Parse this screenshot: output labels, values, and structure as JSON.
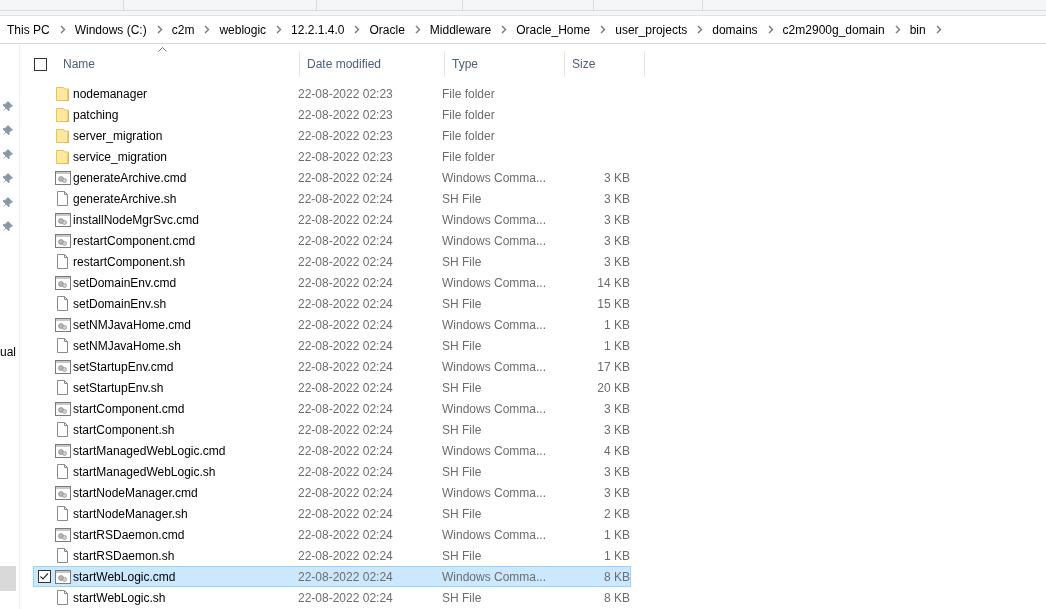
{
  "breadcrumb": [
    "This PC",
    "Windows (C:)",
    "c2m",
    "weblogic",
    "12.2.1.4.0",
    "Oracle",
    "Middleware",
    "Oracle_Home",
    "user_projects",
    "domains",
    "c2m2900g_domain",
    "bin"
  ],
  "nav_items": [
    {
      "label": "ual",
      "selected": false
    },
    {
      "selected": true
    }
  ],
  "table": {
    "select_all": {
      "checked": false
    },
    "columns": [
      {
        "label": "Name",
        "sorted": true
      },
      {
        "label": "Date modified",
        "sorted": false
      },
      {
        "label": "Type",
        "sorted": false
      },
      {
        "label": "Size",
        "sorted": false
      }
    ],
    "rows": [
      {
        "kind": "folder",
        "name": "nodemanager",
        "date": "22-08-2022 02:23",
        "type": "File folder",
        "selected": false
      },
      {
        "kind": "folder",
        "name": "patching",
        "date": "22-08-2022 02:23",
        "type": "File folder",
        "selected": false
      },
      {
        "kind": "folder",
        "name": "server_migration",
        "date": "22-08-2022 02:23",
        "type": "File folder",
        "selected": false
      },
      {
        "kind": "folder",
        "name": "service_migration",
        "date": "22-08-2022 02:23",
        "type": "File folder",
        "selected": false
      },
      {
        "kind": "cmd",
        "name": "generateArchive.cmd",
        "date": "22-08-2022 02:24",
        "type": "Windows Comma...",
        "size": "3 KB",
        "selected": false
      },
      {
        "kind": "sh",
        "name": "generateArchive.sh",
        "date": "22-08-2022 02:24",
        "type": "SH File",
        "size": "3 KB",
        "selected": false
      },
      {
        "kind": "cmd",
        "name": "installNodeMgrSvc.cmd",
        "date": "22-08-2022 02:24",
        "type": "Windows Comma...",
        "size": "3 KB",
        "selected": false
      },
      {
        "kind": "cmd",
        "name": "restartComponent.cmd",
        "date": "22-08-2022 02:24",
        "type": "Windows Comma...",
        "size": "3 KB",
        "selected": false
      },
      {
        "kind": "sh",
        "name": "restartComponent.sh",
        "date": "22-08-2022 02:24",
        "type": "SH File",
        "size": "3 KB",
        "selected": false
      },
      {
        "kind": "cmd",
        "name": "setDomainEnv.cmd",
        "date": "22-08-2022 02:24",
        "type": "Windows Comma...",
        "size": "14 KB",
        "selected": false
      },
      {
        "kind": "sh",
        "name": "setDomainEnv.sh",
        "date": "22-08-2022 02:24",
        "type": "SH File",
        "size": "15 KB",
        "selected": false
      },
      {
        "kind": "cmd",
        "name": "setNMJavaHome.cmd",
        "date": "22-08-2022 02:24",
        "type": "Windows Comma...",
        "size": "1 KB",
        "selected": false
      },
      {
        "kind": "sh",
        "name": "setNMJavaHome.sh",
        "date": "22-08-2022 02:24",
        "type": "SH File",
        "size": "1 KB",
        "selected": false
      },
      {
        "kind": "cmd",
        "name": "setStartupEnv.cmd",
        "date": "22-08-2022 02:24",
        "type": "Windows Comma...",
        "size": "17 KB",
        "selected": false
      },
      {
        "kind": "sh",
        "name": "setStartupEnv.sh",
        "date": "22-08-2022 02:24",
        "type": "SH File",
        "size": "20 KB",
        "selected": false
      },
      {
        "kind": "cmd",
        "name": "startComponent.cmd",
        "date": "22-08-2022 02:24",
        "type": "Windows Comma...",
        "size": "3 KB",
        "selected": false
      },
      {
        "kind": "sh",
        "name": "startComponent.sh",
        "date": "22-08-2022 02:24",
        "type": "SH File",
        "size": "3 KB",
        "selected": false
      },
      {
        "kind": "cmd",
        "name": "startManagedWebLogic.cmd",
        "date": "22-08-2022 02:24",
        "type": "Windows Comma...",
        "size": "4 KB",
        "selected": false
      },
      {
        "kind": "sh",
        "name": "startManagedWebLogic.sh",
        "date": "22-08-2022 02:24",
        "type": "SH File",
        "size": "3 KB",
        "selected": false
      },
      {
        "kind": "cmd",
        "name": "startNodeManager.cmd",
        "date": "22-08-2022 02:24",
        "type": "Windows Comma...",
        "size": "3 KB",
        "selected": false
      },
      {
        "kind": "sh",
        "name": "startNodeManager.sh",
        "date": "22-08-2022 02:24",
        "type": "SH File",
        "size": "2 KB",
        "selected": false
      },
      {
        "kind": "cmd",
        "name": "startRSDaemon.cmd",
        "date": "22-08-2022 02:24",
        "type": "Windows Comma...",
        "size": "1 KB",
        "selected": false
      },
      {
        "kind": "sh",
        "name": "startRSDaemon.sh",
        "date": "22-08-2022 02:24",
        "type": "SH File",
        "size": "1 KB",
        "selected": false
      },
      {
        "kind": "cmd",
        "name": "startWebLogic.cmd",
        "date": "22-08-2022 02:24",
        "type": "Windows Comma...",
        "size": "8 KB",
        "selected": true
      },
      {
        "kind": "sh",
        "name": "startWebLogic.sh",
        "date": "22-08-2022 02:24",
        "type": "SH File",
        "size": "8 KB",
        "selected": false
      }
    ]
  }
}
